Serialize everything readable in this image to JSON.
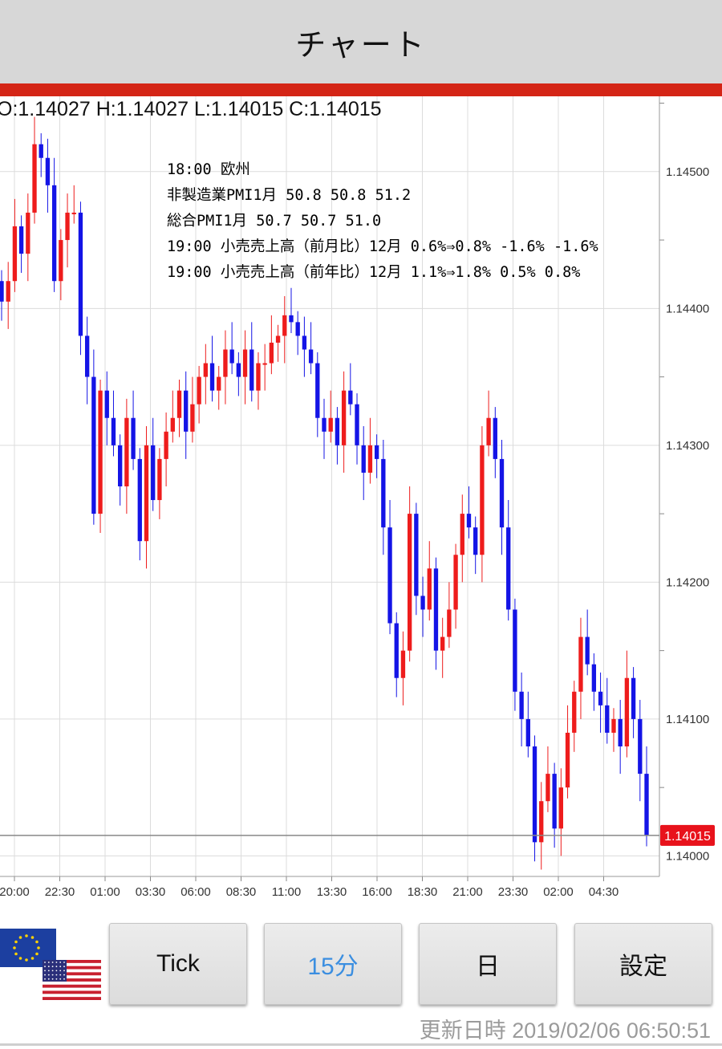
{
  "header": {
    "title": "チャート"
  },
  "ohlc": {
    "text": "O:1.14027 H:1.14027 L:1.14015 C:1.14015"
  },
  "events": [
    "18:00 欧州",
    "非製造業PMI1月 50.8 50.8 51.2",
    "総合PMI1月 50.7 50.7 51.0",
    "19:00 小売売上高（前月比）12月 0.6%⇒0.8% -1.6% -1.6%",
    "19:00 小売売上高（前年比）12月 1.1%⇒1.8% 0.5% 0.8%"
  ],
  "chart_data": {
    "type": "candlestick",
    "y_ticks": [
      "1.14500",
      "1.14400",
      "1.14300",
      "1.14200",
      "1.14100",
      "1.14000"
    ],
    "x_ticks": [
      "20:00",
      "22:30",
      "01:00",
      "03:30",
      "06:00",
      "08:30",
      "11:00",
      "13:30",
      "16:00",
      "18:30",
      "21:00",
      "23:30",
      "02:00",
      "04:30"
    ],
    "ylim": [
      1.13985,
      1.14555
    ],
    "current_price": "1.14015",
    "colors": {
      "up": "#ee1c1c",
      "down": "#1414e6",
      "price_tag": "#e8121b",
      "grid": "#dcdcdc"
    },
    "closes": [
      1.14405,
      1.1442,
      1.1446,
      1.1444,
      1.1447,
      1.1452,
      1.1451,
      1.1449,
      1.1442,
      1.1445,
      1.1447,
      1.1447,
      1.1438,
      1.1435,
      1.1425,
      1.1434,
      1.1432,
      1.143,
      1.1427,
      1.1432,
      1.1429,
      1.1423,
      1.143,
      1.1426,
      1.1429,
      1.1431,
      1.1432,
      1.1434,
      1.1431,
      1.1433,
      1.1435,
      1.1436,
      1.1434,
      1.1435,
      1.1437,
      1.1436,
      1.1435,
      1.1437,
      1.1434,
      1.1436,
      1.1436,
      1.14375,
      1.1438,
      1.14395,
      1.1439,
      1.1438,
      1.1437,
      1.1436,
      1.1432,
      1.1431,
      1.1432,
      1.143,
      1.1434,
      1.1433,
      1.143,
      1.1428,
      1.143,
      1.1429,
      1.1424,
      1.1417,
      1.1413,
      1.1415,
      1.1425,
      1.1419,
      1.1418,
      1.1421,
      1.1415,
      1.1416,
      1.1418,
      1.1422,
      1.1425,
      1.1424,
      1.1422,
      1.143,
      1.1432,
      1.1429,
      1.1424,
      1.1418,
      1.1412,
      1.141,
      1.1408,
      1.1401,
      1.1404,
      1.1406,
      1.1402,
      1.1405,
      1.1409,
      1.1412,
      1.1416,
      1.1414,
      1.1412,
      1.1411,
      1.1409,
      1.141,
      1.1408,
      1.1413,
      1.141,
      1.1406,
      1.14015
    ]
  },
  "toolbar": {
    "buttons": [
      "Tick",
      "15分",
      "日",
      "設定"
    ],
    "active": "15分",
    "updated_label": "更新日時",
    "updated_value": "2019/02/06 06:50:51"
  }
}
